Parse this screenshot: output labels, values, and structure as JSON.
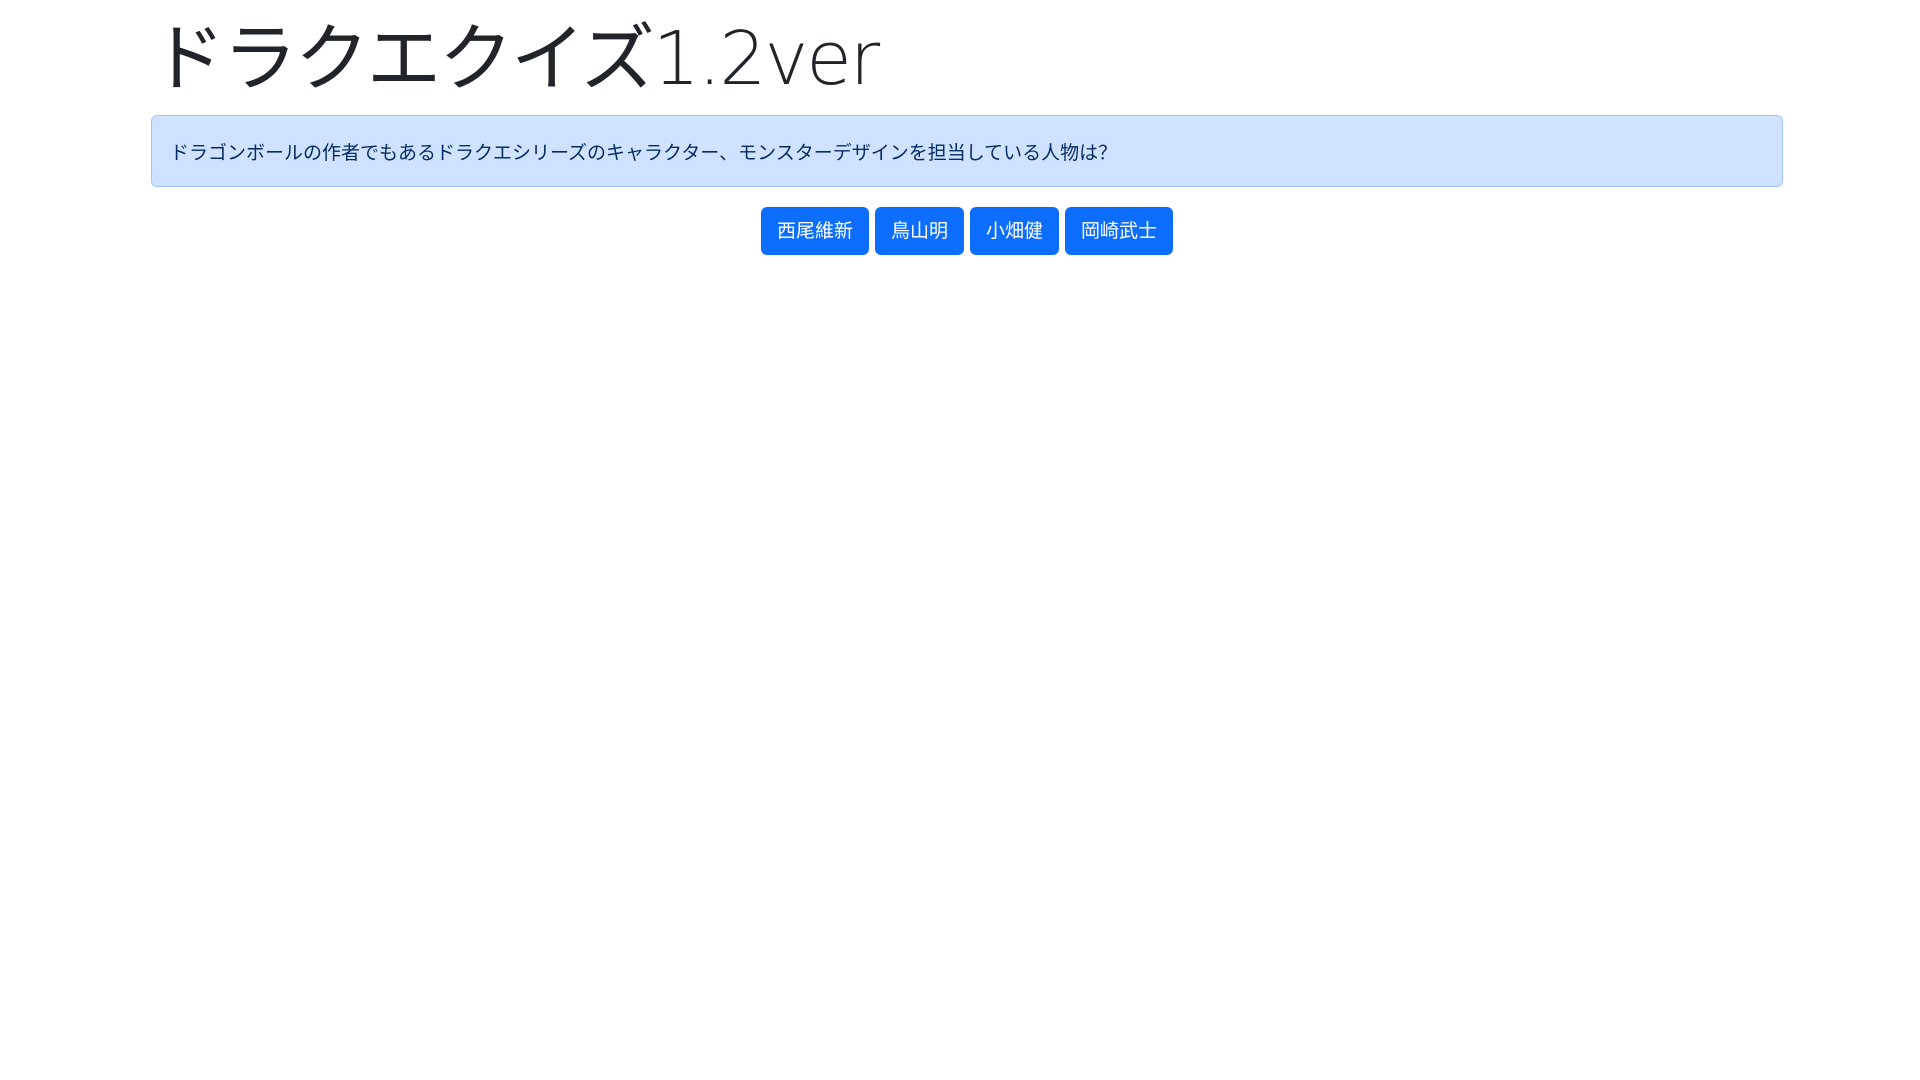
{
  "title": "ドラクエクイズ1.2ver",
  "question": "ドラゴンボールの作者でもあるドラクエシリーズのキャラクター、モンスターデザインを担当している人物は？",
  "answers": [
    {
      "label": "西尾維新"
    },
    {
      "label": "鳥山明"
    },
    {
      "label": "小畑健"
    },
    {
      "label": "岡崎武士"
    }
  ],
  "colors": {
    "primary": "#0d6efd",
    "alert_bg": "#cfe2ff",
    "alert_border": "#9ec5fe",
    "alert_text": "#052c65"
  }
}
